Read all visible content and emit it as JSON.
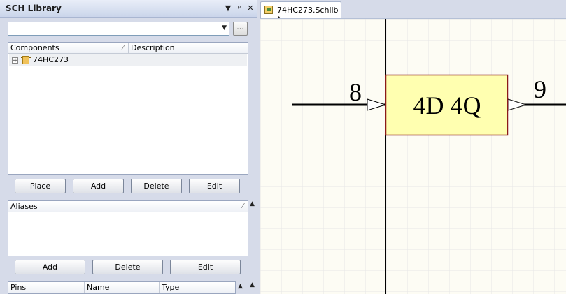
{
  "panel": {
    "title": "SCH Library",
    "menu_icon": "dropdown-arrow-icon",
    "pin_icon": "pin-icon",
    "close_icon": "close-icon",
    "filter_value": "",
    "browse_label": "..."
  },
  "components": {
    "headers": [
      "Components",
      "Description"
    ],
    "rows": [
      {
        "name": "74HC273",
        "description": ""
      }
    ]
  },
  "component_buttons": {
    "place": "Place",
    "add": "Add",
    "delete": "Delete",
    "edit": "Edit"
  },
  "aliases": {
    "header": "Aliases"
  },
  "alias_buttons": {
    "add": "Add",
    "delete": "Delete",
    "edit": "Edit"
  },
  "pins": {
    "headers": [
      "Pins",
      "Name",
      "Type"
    ]
  },
  "tab": {
    "label": "74HC273.Schlib *"
  },
  "schematic": {
    "body_fill": "#ffffb0",
    "body_stroke": "#8b1a1a",
    "body_label": "4D  4Q",
    "pin_left_number": "8",
    "pin_right_number": "9"
  }
}
